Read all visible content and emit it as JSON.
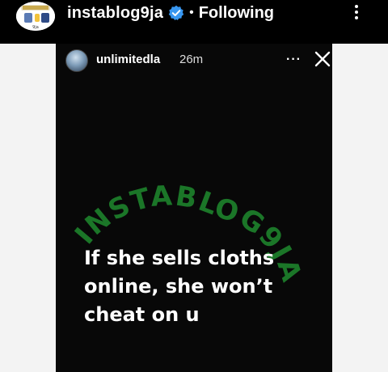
{
  "post": {
    "username": "instablog9ja",
    "separator": "•",
    "follow_status": "Following",
    "avatar_icon": "instablog9ja-logo"
  },
  "story": {
    "username": "unlimitedla",
    "time": "26m",
    "more_label": "···",
    "close_icon": "close-icon",
    "caption_lines": [
      "If she sells cloths",
      "online, she won’t",
      "cheat on u"
    ],
    "watermark_text": "INSTABLOG9JA",
    "watermark_color": "#1e8a2e"
  },
  "colors": {
    "header_bg": "#000000",
    "story_bg": "#080808",
    "verified": "#3897f0",
    "page_bg": "#f3f3f3"
  }
}
